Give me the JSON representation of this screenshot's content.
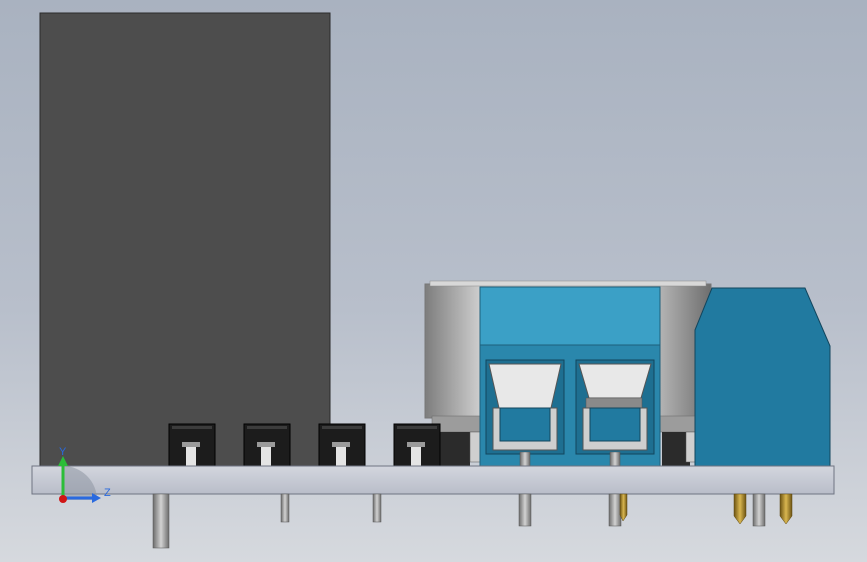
{
  "viewport": {
    "background_top": "#a9b2c0",
    "background_bottom": "#d6d9de"
  },
  "model": {
    "components": [
      {
        "name": "relay-housing",
        "color": "#4d4d4d"
      },
      {
        "name": "pcb-board",
        "color": "#c9cdd8"
      },
      {
        "name": "electrolytic-capacitor",
        "color": "#b5b5b5"
      },
      {
        "name": "terminal-block",
        "color": "#3ba0c6"
      },
      {
        "name": "side-connector",
        "color": "#217aa0"
      },
      {
        "name": "header-pins",
        "color": "#1c1c1c"
      }
    ]
  },
  "triad": {
    "y_label": "Y",
    "z_label": "Z",
    "y_color": "#2bbd38",
    "z_color": "#2a6adf",
    "origin_color": "#d01515"
  }
}
